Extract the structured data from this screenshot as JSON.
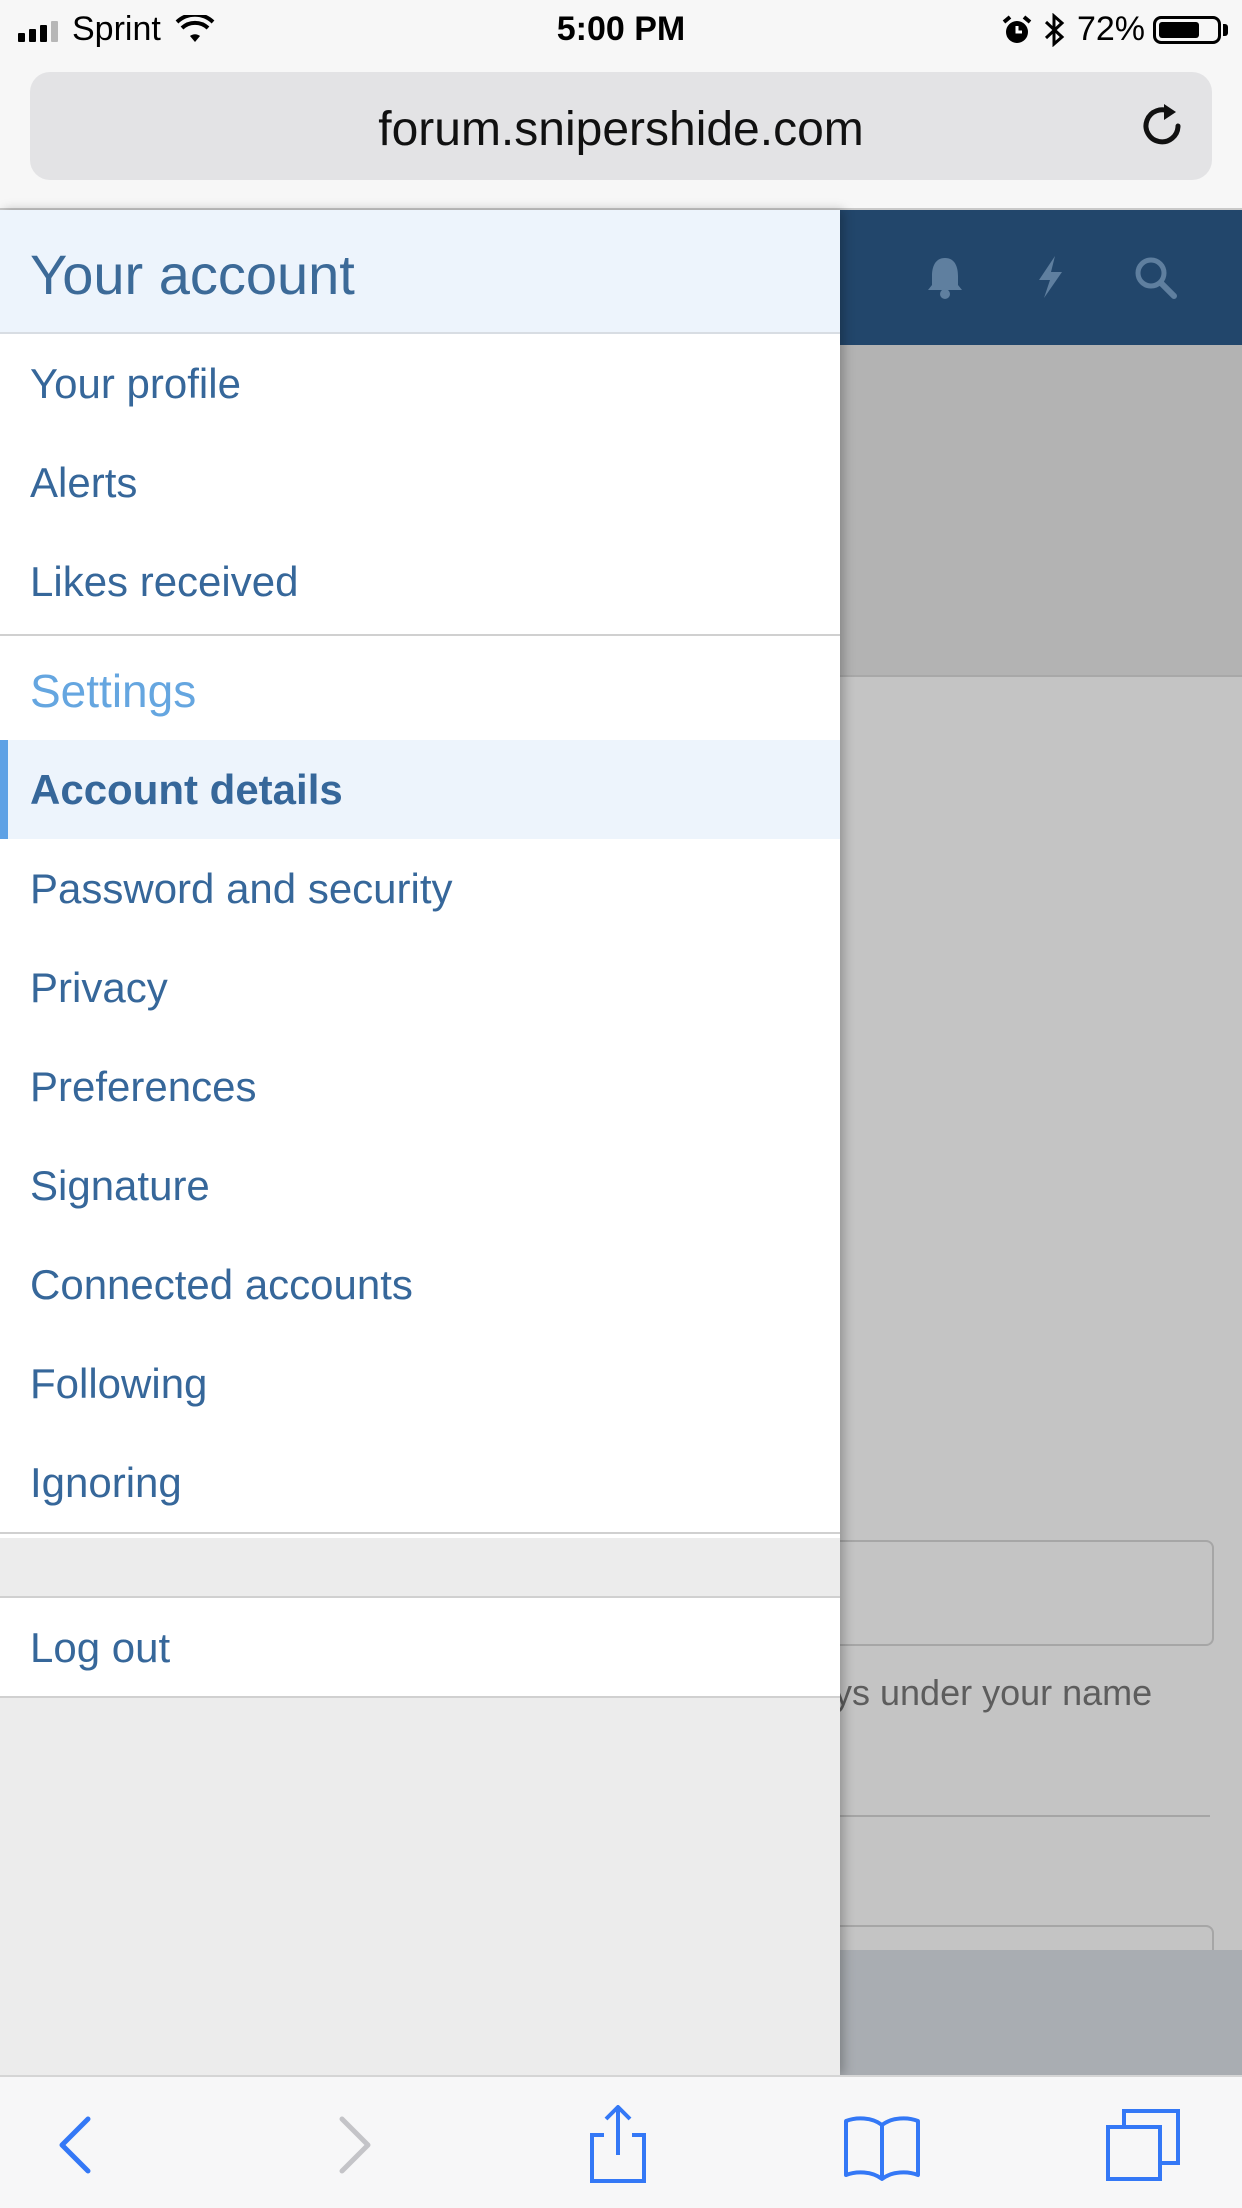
{
  "status_bar": {
    "carrier": "Sprint",
    "time": "5:00 PM",
    "battery_percent": "72%",
    "battery_level": 0.72
  },
  "browser": {
    "url": "forum.snipershide.com"
  },
  "background_page": {
    "hint_text": "ys under your name"
  },
  "drawer": {
    "title": "Your account",
    "items_top": [
      "Your profile",
      "Alerts",
      "Likes received"
    ],
    "settings_heading": "Settings",
    "settings_items": [
      "Account details",
      "Password and security",
      "Privacy",
      "Preferences",
      "Signature",
      "Connected accounts",
      "Following",
      "Ignoring"
    ],
    "active_item": "Account details",
    "logout": "Log out"
  },
  "colors": {
    "nav_dark": "#22466b",
    "link": "#36679a",
    "heading": "#65a6e0",
    "active_accent": "#5ea1e5",
    "ios_blue": "#3478f6"
  },
  "icons": [
    "wifi-icon",
    "alarm-icon",
    "bluetooth-icon",
    "reload-icon",
    "bell-icon",
    "bolt-icon",
    "search-icon",
    "back-icon",
    "forward-icon",
    "share-icon",
    "bookmarks-icon",
    "tabs-icon"
  ]
}
